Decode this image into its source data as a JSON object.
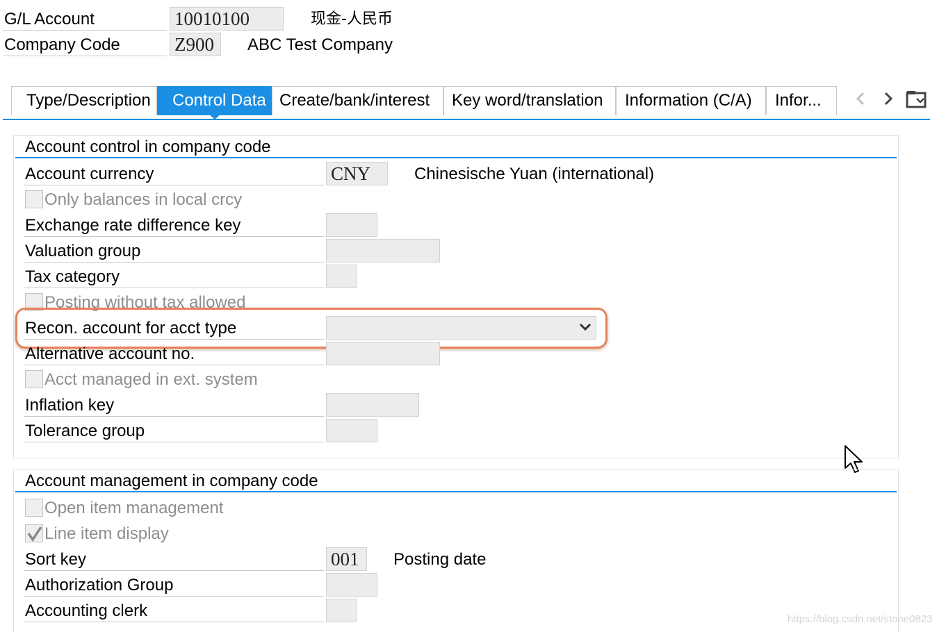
{
  "header": {
    "gl_account_label": "G/L Account",
    "gl_account_value": "10010100",
    "gl_account_desc": "现金-人民币",
    "company_code_label": "Company Code",
    "company_code_value": "Z900",
    "company_code_desc": "ABC Test Company"
  },
  "tabs": [
    {
      "label": "Type/Description",
      "active": false
    },
    {
      "label": "Control Data",
      "active": true
    },
    {
      "label": "Create/bank/interest",
      "active": false
    },
    {
      "label": "Key word/translation",
      "active": false
    },
    {
      "label": "Information (C/A)",
      "active": false
    },
    {
      "label": "Infor...",
      "active": false
    }
  ],
  "tab_nav": {
    "prev_icon": "chevron-left-icon",
    "next_icon": "chevron-right-icon",
    "menu_icon": "tab-list-icon"
  },
  "account_control": {
    "title": "Account control in company code",
    "account_currency_label": "Account currency",
    "account_currency_value": "CNY",
    "account_currency_desc": "Chinesische Yuan (international)",
    "only_balances_label": "Only balances in local crcy",
    "only_balances_checked": false,
    "exchange_rate_label": "Exchange rate difference key",
    "exchange_rate_value": "",
    "valuation_group_label": "Valuation group",
    "valuation_group_value": "",
    "tax_category_label": "Tax category",
    "tax_category_value": "",
    "posting_without_tax_label": "Posting without tax allowed",
    "posting_without_tax_checked": false,
    "recon_account_label": "Recon. account for acct type",
    "recon_account_value": "",
    "alternative_account_label": "Alternative account no.",
    "alternative_account_value": "",
    "acct_managed_label": "Acct managed in ext. system",
    "acct_managed_checked": false,
    "inflation_key_label": "Inflation key",
    "inflation_key_value": "",
    "tolerance_group_label": "Tolerance group",
    "tolerance_group_value": ""
  },
  "account_management": {
    "title": "Account management in company code",
    "open_item_label": "Open item management",
    "open_item_checked": false,
    "line_item_label": "Line item display",
    "line_item_checked": true,
    "sort_key_label": "Sort key",
    "sort_key_value": "001",
    "sort_key_desc": "Posting date",
    "authorization_group_label": "Authorization Group",
    "authorization_group_value": "",
    "accounting_clerk_label": "Accounting clerk",
    "accounting_clerk_value": ""
  },
  "highlight_color": "#e8805a",
  "accent_color": "#1a8fe3",
  "watermark": "https://blog.csdn.net/stone0823"
}
